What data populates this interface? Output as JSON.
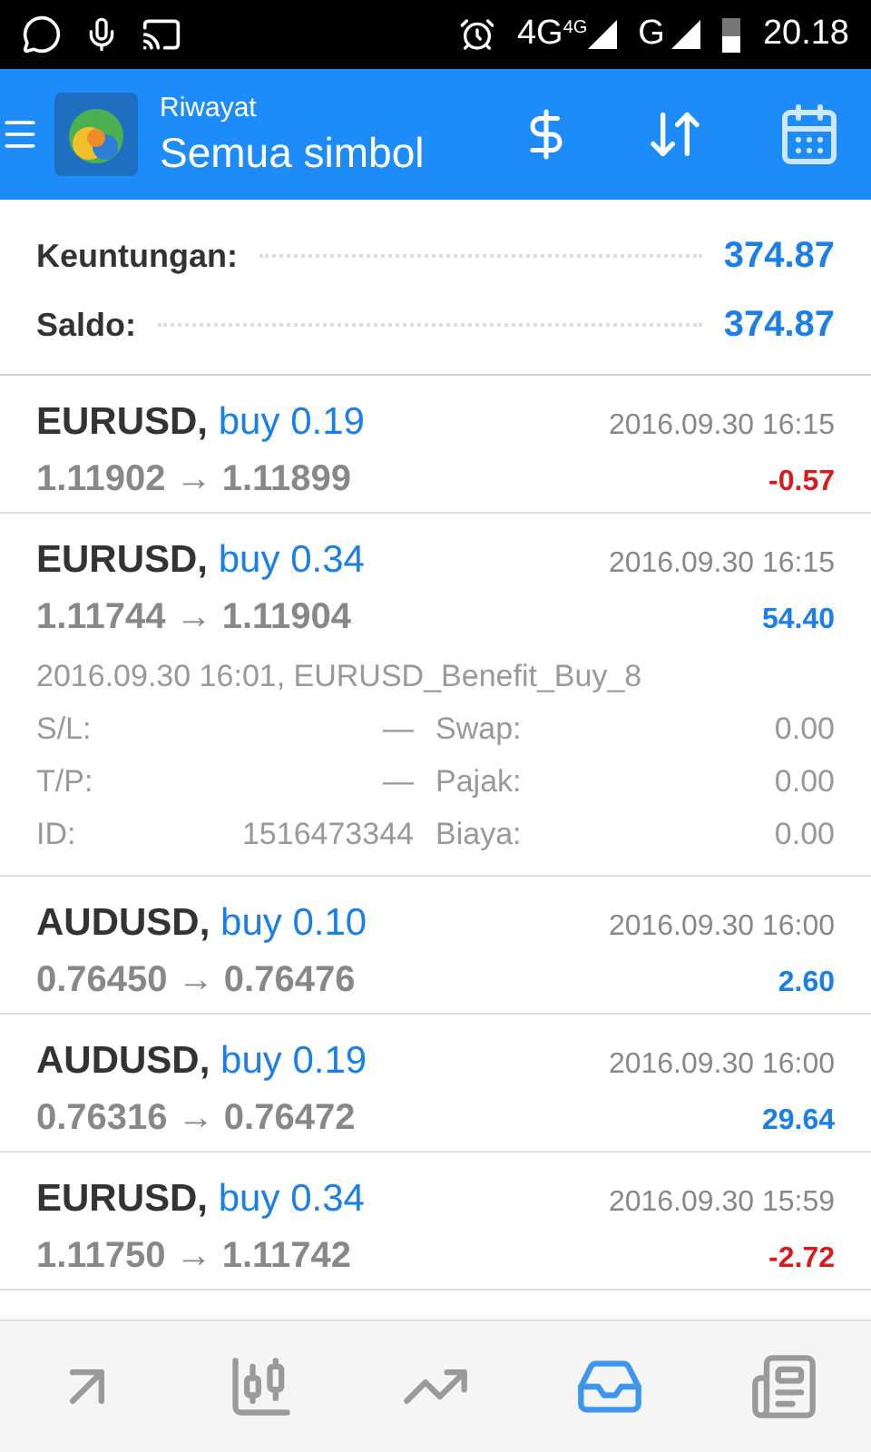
{
  "status_bar": {
    "network": "4G",
    "network_badge": "4G",
    "network_2": "G",
    "time": "20.18"
  },
  "header": {
    "title": "Riwayat",
    "subtitle": "Semua simbol"
  },
  "summary": [
    {
      "label": "Keuntungan:",
      "value": "374.87"
    },
    {
      "label": "Saldo:",
      "value": "374.87"
    }
  ],
  "trades": [
    {
      "symbol": "EURUSD,",
      "type": "buy",
      "volume": "0.19",
      "open_price": "1.11902",
      "arrow": "→",
      "close_price": "1.11899",
      "time": "2016.09.30 16:15",
      "profit": "-0.57",
      "loss": true,
      "expanded": false
    },
    {
      "symbol": "EURUSD,",
      "type": "buy",
      "volume": "0.34",
      "open_price": "1.11744",
      "arrow": "→",
      "close_price": "1.11904",
      "time": "2016.09.30 16:15",
      "profit": "54.40",
      "loss": false,
      "expanded": true,
      "details": {
        "comment": "2016.09.30 16:01, EURUSD_Benefit_Buy_8",
        "fields": [
          {
            "label": "S/L:",
            "value": "—",
            "label_2": "Swap:",
            "value_2": "0.00"
          },
          {
            "label": "T/P:",
            "value": "—",
            "label_2": "Pajak:",
            "value_2": "0.00"
          },
          {
            "label": "ID:",
            "value": "1516473344",
            "label_2": "Biaya:",
            "value_2": "0.00"
          }
        ]
      }
    },
    {
      "symbol": "AUDUSD,",
      "type": "buy",
      "volume": "0.10",
      "open_price": "0.76450",
      "arrow": "→",
      "close_price": "0.76476",
      "time": "2016.09.30 16:00",
      "profit": "2.60",
      "loss": false,
      "expanded": false
    },
    {
      "symbol": "AUDUSD,",
      "type": "buy",
      "volume": "0.19",
      "open_price": "0.76316",
      "arrow": "→",
      "close_price": "0.76472",
      "time": "2016.09.30 16:00",
      "profit": "29.64",
      "loss": false,
      "expanded": false
    },
    {
      "symbol": "EURUSD,",
      "type": "buy",
      "volume": "0.34",
      "open_price": "1.11750",
      "arrow": "→",
      "close_price": "1.11742",
      "time": "2016.09.30 15:59",
      "profit": "-2.72",
      "loss": true,
      "expanded": false
    }
  ],
  "bottom_nav": [
    {
      "kind": "trade",
      "selected": false
    },
    {
      "kind": "chart",
      "selected": false
    },
    {
      "kind": "trend",
      "selected": false
    },
    {
      "kind": "history",
      "selected": true
    },
    {
      "kind": "news",
      "selected": false
    }
  ]
}
